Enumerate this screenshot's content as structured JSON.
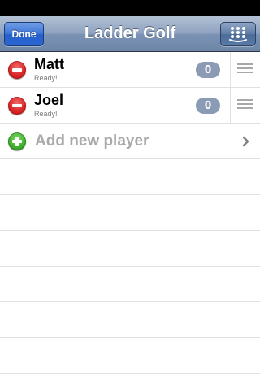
{
  "nav": {
    "title": "Ladder Golf",
    "done_label": "Done",
    "menu_icon": "grid-dots-icon"
  },
  "players": [
    {
      "name": "Matt",
      "status": "Ready!",
      "score": "0"
    },
    {
      "name": "Joel",
      "status": "Ready!",
      "score": "0"
    }
  ],
  "add_row": {
    "label": "Add new player"
  },
  "colors": {
    "nav_bar": "#7b93b4",
    "done_button": "#2a66d2",
    "delete": "#d62323",
    "add": "#3fae2c",
    "badge": "#8c9bb5",
    "placeholder_text": "#a9a9a9"
  }
}
